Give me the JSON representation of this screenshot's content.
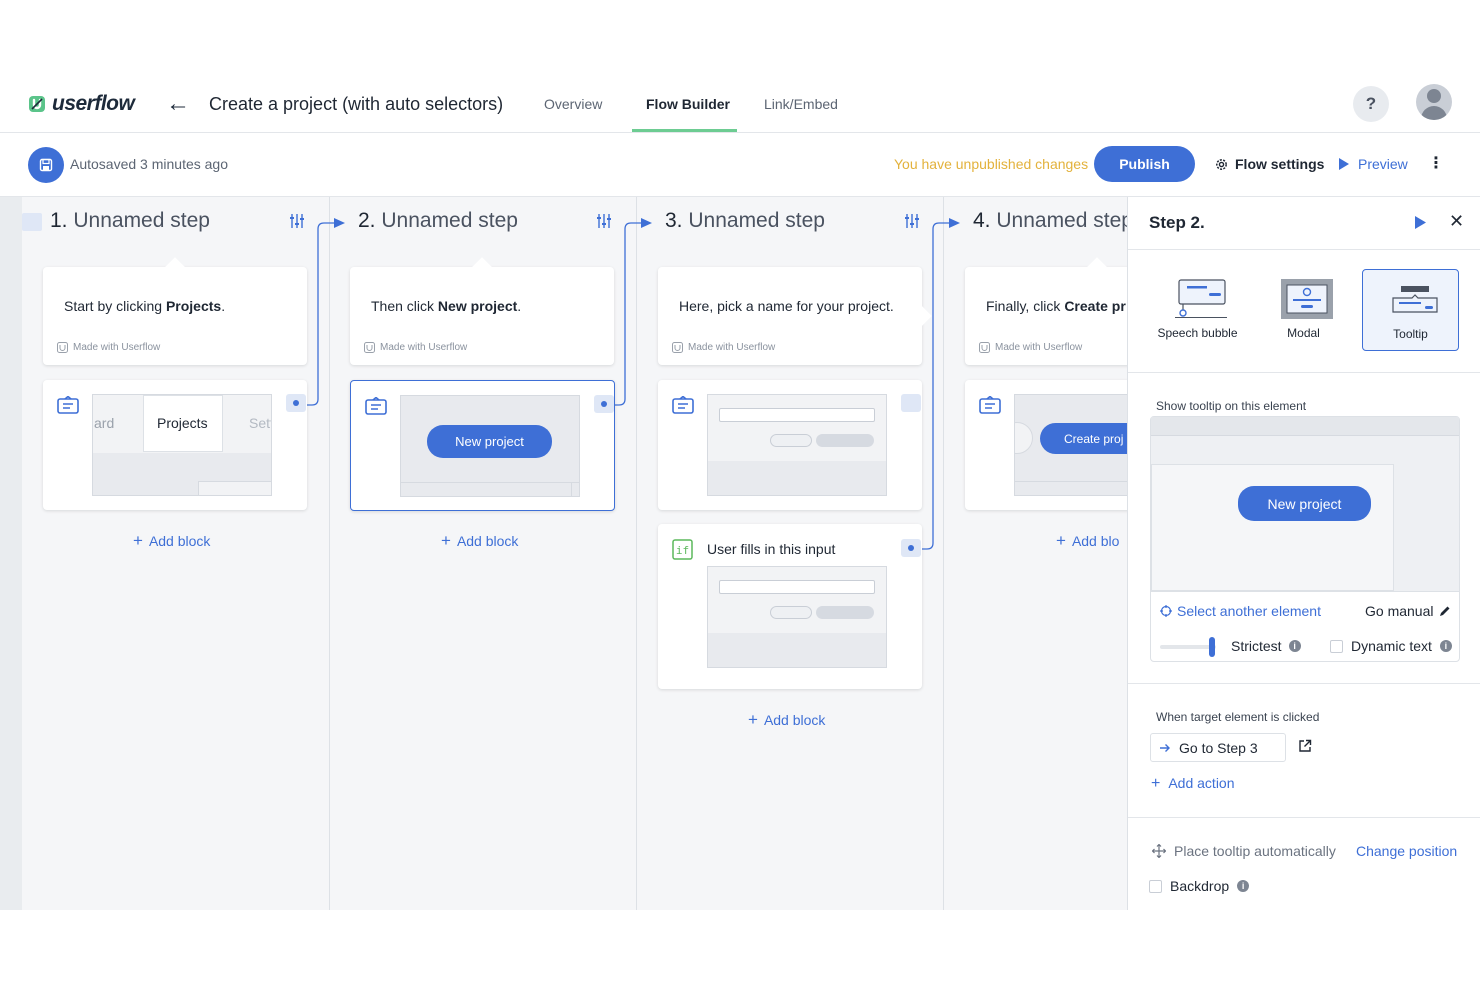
{
  "header": {
    "logo_text": "userflow",
    "flow_title": "Create a project (with auto selectors)",
    "tabs": [
      {
        "label": "Overview"
      },
      {
        "label": "Flow Builder"
      },
      {
        "label": "Link/Embed"
      }
    ],
    "help_label": "?"
  },
  "toolbar": {
    "autosave_text": "Autosaved 3 minutes ago",
    "unpublished_text": "You have unpublished changes",
    "publish_label": "Publish",
    "flow_settings_label": "Flow settings",
    "preview_label": "Preview",
    "more_label": "⋮"
  },
  "steps": [
    {
      "number": "1.",
      "name": "Unnamed step",
      "bubble_prefix": "Start by clicking ",
      "bubble_bold": "Projects",
      "bubble_suffix": ".",
      "made_with": "Made with Userflow",
      "thumb_left": "ard",
      "thumb_center": "Projects",
      "thumb_right": "Sett",
      "add_block": "Add block"
    },
    {
      "number": "2.",
      "name": "Unnamed step",
      "bubble_prefix": "Then click ",
      "bubble_bold": "New project",
      "bubble_suffix": ".",
      "made_with": "Made with Userflow",
      "thumb_button": "New project",
      "add_block": "Add block"
    },
    {
      "number": "3.",
      "name": "Unnamed step",
      "bubble_prefix": "Here, pick a name for your project.",
      "made_with": "Made with Userflow",
      "condition_label": "User fills in this input",
      "add_block": "Add block"
    },
    {
      "number": "4.",
      "name": "Unnamed step",
      "bubble_prefix": "Finally, click ",
      "bubble_bold": "Create pr",
      "made_with": "Made with Userflow",
      "thumb_button": "Create proj",
      "add_block": "Add blo"
    }
  ],
  "panel": {
    "title": "Step 2.",
    "types": [
      {
        "label": "Speech bubble",
        "icon": "speech-bubble-icon"
      },
      {
        "label": "Modal",
        "icon": "modal-icon"
      },
      {
        "label": "Tooltip",
        "icon": "tooltip-icon",
        "selected": true
      }
    ],
    "show_tooltip_label": "Show tooltip on this element",
    "preview_button": "New project",
    "select_another": "Select another element",
    "go_manual": "Go manual",
    "strictness_label": "Strictest",
    "strictness_value": 1.0,
    "dynamic_text_label": "Dynamic text",
    "dynamic_text_checked": false,
    "when_clicked_label": "When target element is clicked",
    "goto_label": "Go to Step 3",
    "add_action": "Add action",
    "place_auto_label": "Place tooltip automatically",
    "change_position": "Change position",
    "backdrop_label": "Backdrop",
    "backdrop_checked": false
  },
  "colors": {
    "accent": "#3e6fd6",
    "warning_text": "#e3b23c",
    "tab_underline": "#6dcc92",
    "condition_green": "#5cb85c"
  }
}
